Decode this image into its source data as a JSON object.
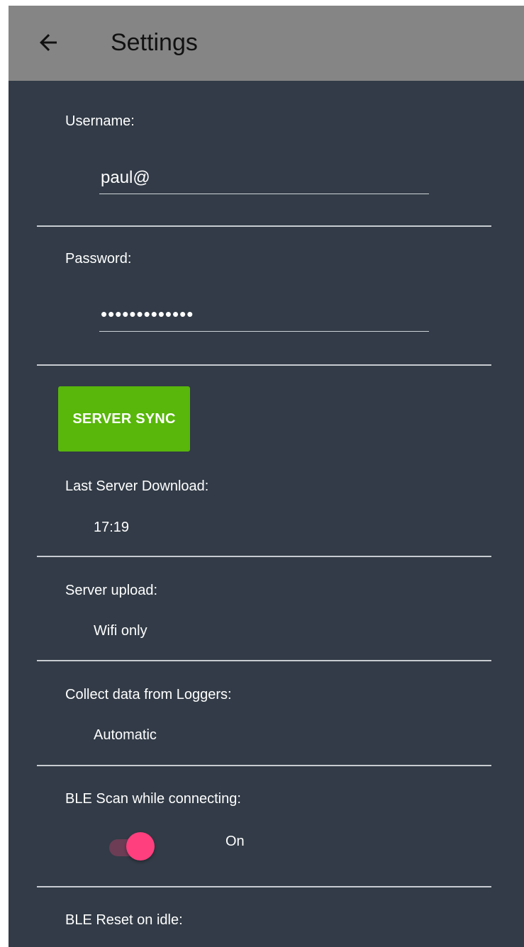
{
  "header": {
    "title": "Settings",
    "back_icon": "arrow-back-icon"
  },
  "username": {
    "label": "Username:",
    "value": "paul@"
  },
  "password": {
    "label": "Password:",
    "value": "•••••••••••••"
  },
  "sync": {
    "button_label": "SERVER SYNC",
    "last_download_label": "Last Server Download:",
    "last_download_value": "17:19"
  },
  "upload": {
    "label": "Server upload:",
    "value": "Wifi only"
  },
  "collect": {
    "label": "Collect data from Loggers:",
    "value": "Automatic"
  },
  "ble_scan": {
    "label": "BLE Scan while connecting:",
    "state_label": "On",
    "enabled": true
  },
  "ble_reset": {
    "label": "BLE Reset on idle:"
  },
  "colors": {
    "appbar": "#858585",
    "background": "#323b47",
    "sync_button": "#58b70a",
    "switch_thumb": "#ff3f7e",
    "switch_track": "#6c3d55"
  }
}
